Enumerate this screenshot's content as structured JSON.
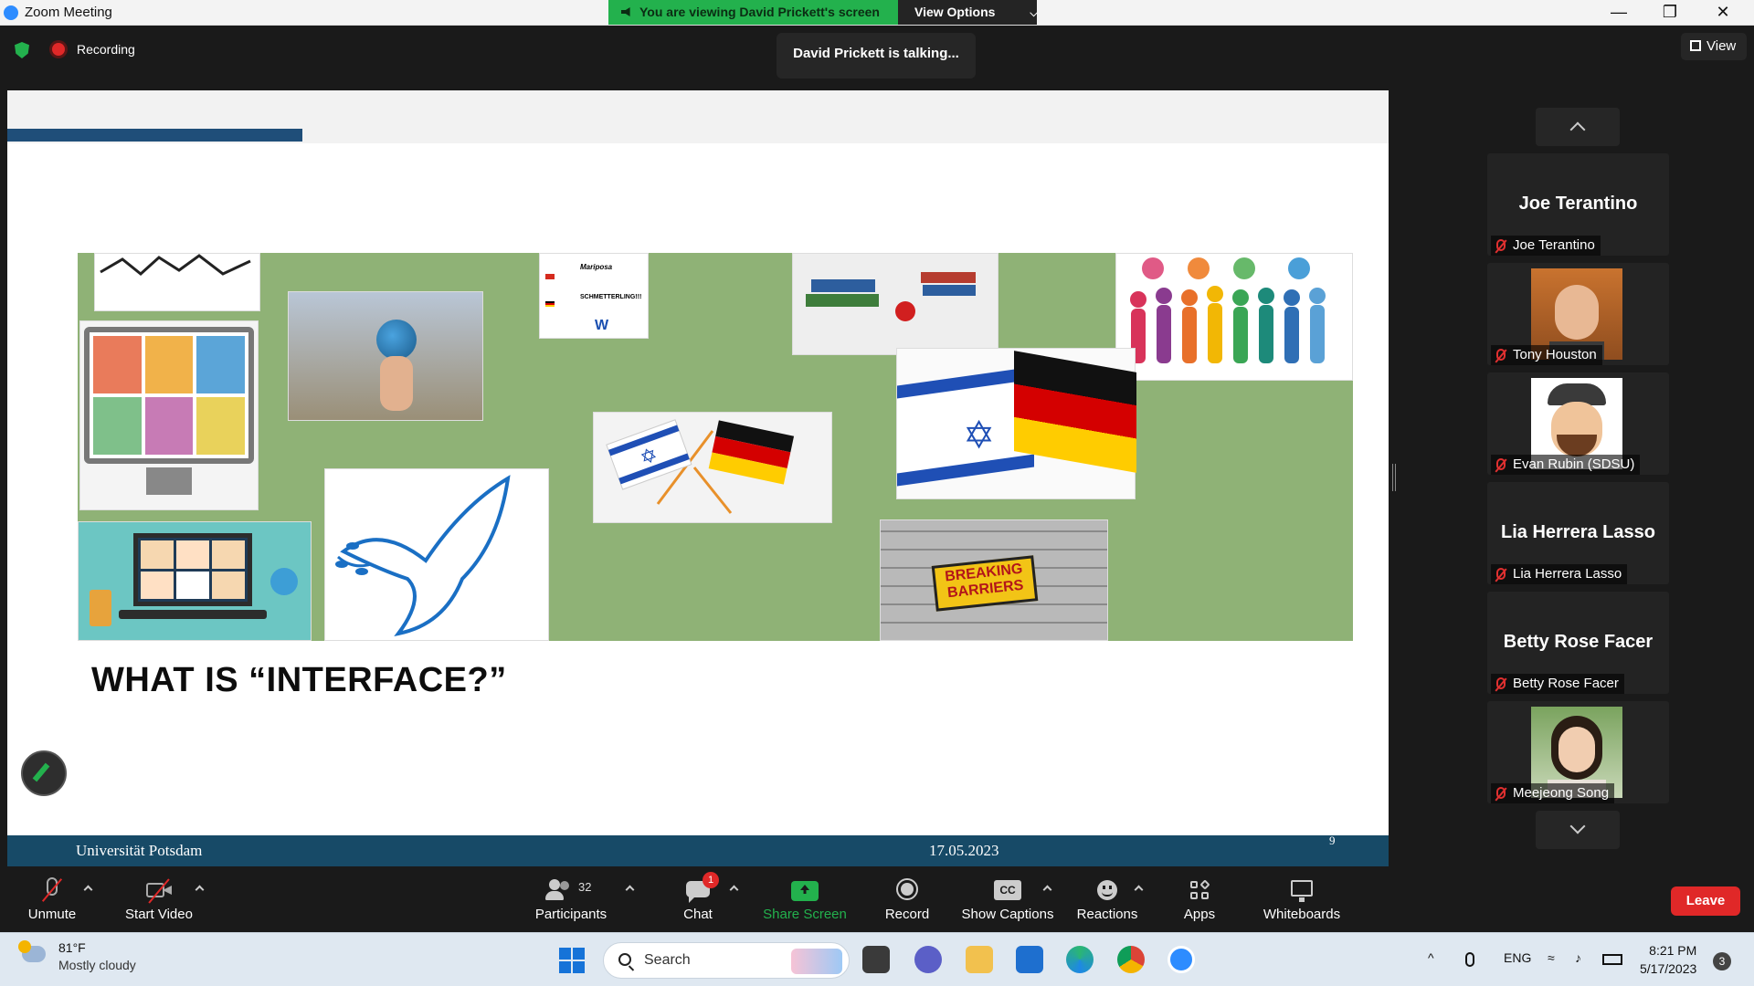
{
  "window": {
    "title": "Zoom Meeting",
    "share_banner": "You are viewing David Prickett's screen",
    "view_options": "View Options",
    "controls": [
      "—",
      "❐",
      "✕"
    ]
  },
  "meeting_bar": {
    "recording_label": "Recording",
    "talking_indicator": "David Prickett is talking...",
    "view_label": "View"
  },
  "slide": {
    "title": "WHAT IS “INTERFACE?”",
    "footer_left": "Universität Potsdam",
    "footer_date": "17.05.2023",
    "page_number": "9",
    "collage_texts": {
      "mariposa": "Mariposa",
      "schmetterling": "SCHMETTERLING!!!",
      "breaking": "BREAKING",
      "barriers": "BARRIERS"
    }
  },
  "participants": [
    {
      "name": "Joe Terantino",
      "has_video": false
    },
    {
      "name": "Tony Houston",
      "has_video": true
    },
    {
      "name": "Evan Rubin (SDSU)",
      "has_video": true
    },
    {
      "name": "Lia Herrera Lasso",
      "has_video": false
    },
    {
      "name": "Betty Rose Facer",
      "has_video": false
    },
    {
      "name": "Meejeong Song",
      "has_video": true
    }
  ],
  "toolbar": {
    "unmute": "Unmute",
    "start_video": "Start Video",
    "participants": "Participants",
    "participant_count": "32",
    "chat": "Chat",
    "chat_badge": "1",
    "share_screen": "Share Screen",
    "record": "Record",
    "show_captions": "Show Captions",
    "reactions": "Reactions",
    "apps": "Apps",
    "whiteboards": "Whiteboards",
    "leave": "Leave",
    "cc": "CC"
  },
  "taskbar": {
    "weather_temp": "81°F",
    "weather_desc": "Mostly cloudy",
    "search_placeholder": "Search",
    "language": "ENG",
    "time": "8:21 PM",
    "date": "5/17/2023",
    "notification_count": "3"
  },
  "colors": {
    "accent_green": "#23b14d",
    "leave_red": "#e02828",
    "slide_footer": "#174a67",
    "slide_bar": "#1f4e79",
    "collage_bg": "#8fb276"
  }
}
